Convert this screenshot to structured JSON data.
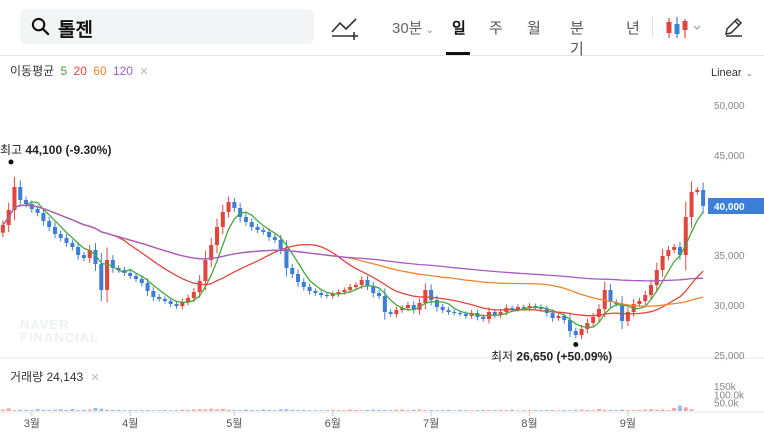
{
  "search": {
    "query": "톨젠"
  },
  "toolbar": {
    "interval_label": "30분",
    "period_tabs": [
      "일",
      "주",
      "월",
      "분기",
      "년"
    ],
    "active_tab": "일",
    "icons": [
      "search-icon",
      "add-indicator-icon",
      "candle-type-icon",
      "pen-icon"
    ]
  },
  "moving_average": {
    "label": "이동평균",
    "periods": [
      "5",
      "20",
      "60",
      "120"
    ],
    "colors": [
      "#46a83c",
      "#e0463c",
      "#f0852d",
      "#a45bc6"
    ]
  },
  "scale_label": "Linear",
  "price_axis": {
    "ticks": [
      "50,000",
      "45,000",
      "35,000",
      "30,000",
      "25,000"
    ],
    "current_price_label": "40,000"
  },
  "annotations": {
    "high": {
      "prefix": "최고",
      "value": "44,100 (-9.30%)"
    },
    "low": {
      "prefix": "최저",
      "value": "26,650 (+50.09%)"
    }
  },
  "volume": {
    "label": "거래량",
    "value": "24,143",
    "axis_ticks": [
      "150k",
      "100.0k",
      "50.0k"
    ]
  },
  "watermark": [
    "NAVER",
    "FINANCIAL"
  ],
  "colors": {
    "up": "#e0463c",
    "down": "#3d7fd6",
    "current_price_bg": "#3d7fd6"
  },
  "chart_data": {
    "type": "candlestick",
    "months": [
      "3월",
      "4월",
      "5월",
      "6월",
      "7월",
      "8월",
      "9월"
    ],
    "ylim": [
      25000,
      52000
    ],
    "high": 44100,
    "low": 26650,
    "close": [
      38000,
      39500,
      41800,
      40500,
      40100,
      39600,
      39200,
      38400,
      37800,
      37100,
      36700,
      36200,
      35800,
      35000,
      34700,
      35500,
      34100,
      31500,
      34500,
      33700,
      33500,
      33200,
      32900,
      32600,
      32200,
      31400,
      30800,
      30600,
      30400,
      30100,
      29900,
      30300,
      30700,
      31300,
      32400,
      34500,
      36000,
      37800,
      39300,
      40300,
      39700,
      38800,
      38300,
      37800,
      37500,
      37300,
      36800,
      36500,
      35600,
      33700,
      33100,
      32300,
      31800,
      31400,
      31200,
      31000,
      30900,
      31100,
      31300,
      31500,
      31800,
      32000,
      32500,
      31900,
      31200,
      30900,
      29300,
      29100,
      29500,
      29700,
      30000,
      29500,
      30200,
      31500,
      30500,
      29800,
      29500,
      29300,
      29200,
      29100,
      28900,
      29200,
      28800,
      28600,
      29300,
      29000,
      29300,
      29700,
      29600,
      29800,
      29700,
      29900,
      29800,
      29600,
      29200,
      28700,
      28900,
      28500,
      27400,
      27000,
      27600,
      28200,
      28800,
      29600,
      31500,
      30300,
      30100,
      28400,
      29300,
      30100,
      30400,
      31000,
      32000,
      33500,
      34900,
      35500,
      35800,
      35000,
      38800,
      41300,
      41500,
      39900
    ],
    "volume_k": [
      9,
      16,
      5,
      8,
      6,
      5,
      11,
      7,
      5,
      8,
      10,
      6,
      12,
      5,
      7,
      9,
      18,
      14,
      8,
      6,
      7,
      5,
      5,
      4,
      5,
      6,
      4,
      5,
      6,
      4,
      5,
      8,
      6,
      9,
      11,
      10,
      14,
      9,
      12,
      7,
      6,
      5,
      8,
      6,
      5,
      9,
      6,
      5,
      10,
      11,
      7,
      5,
      6,
      4,
      5,
      4,
      5,
      7,
      5,
      4,
      8,
      6,
      5,
      7,
      9,
      6,
      6,
      5,
      7,
      8,
      5,
      7,
      9,
      5,
      6,
      4,
      5,
      7,
      4,
      6,
      5,
      4,
      5,
      6,
      5,
      6,
      7,
      5,
      8,
      4,
      5,
      6,
      4,
      5,
      6,
      5,
      4,
      5,
      4,
      7,
      8,
      6,
      5,
      12,
      7,
      6,
      5,
      8,
      5,
      6,
      7,
      9,
      11,
      8,
      9,
      5,
      18,
      32,
      22,
      10
    ]
  }
}
